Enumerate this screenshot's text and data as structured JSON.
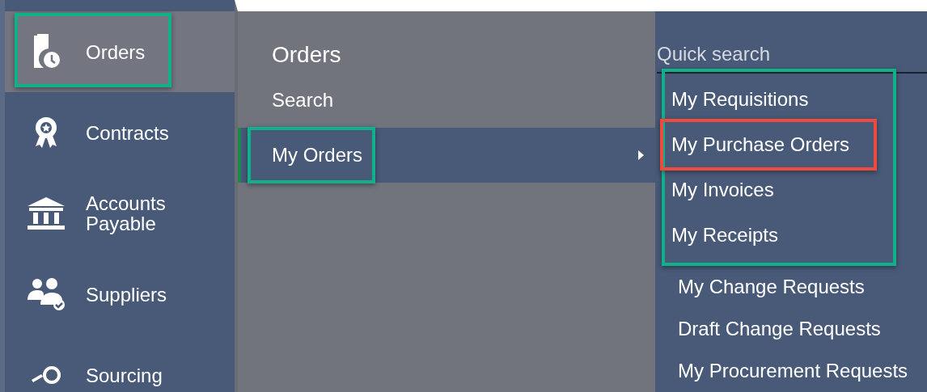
{
  "sidebar": {
    "items": [
      {
        "label": "Orders",
        "kind": "orders",
        "selected": true,
        "highlighted": true
      },
      {
        "label": "Contracts",
        "kind": "contracts",
        "selected": false,
        "highlighted": false
      },
      {
        "label": "Accounts Payable",
        "kind": "bank",
        "selected": false,
        "highlighted": false
      },
      {
        "label": "Suppliers",
        "kind": "suppliers",
        "selected": false,
        "highlighted": false
      },
      {
        "label": "Sourcing",
        "kind": "sourcing",
        "selected": false,
        "highlighted": false
      }
    ]
  },
  "submenu": {
    "title": "Orders",
    "items": [
      {
        "label": "Search",
        "selected": false,
        "highlighted": false,
        "has_children": false
      },
      {
        "label": "My Orders",
        "selected": true,
        "highlighted": true,
        "has_children": true
      }
    ]
  },
  "links_panel": {
    "search": {
      "placeholder": "Quick search"
    },
    "links": [
      {
        "label": "My Requisitions",
        "in_group": true,
        "marked": false
      },
      {
        "label": "My Purchase Orders",
        "in_group": true,
        "marked": true
      },
      {
        "label": "My Invoices",
        "in_group": true,
        "marked": false
      },
      {
        "label": "My Receipts",
        "in_group": true,
        "marked": false
      },
      {
        "label": "My Change Requests",
        "in_group": false,
        "marked": false
      },
      {
        "label": "Draft Change Requests",
        "in_group": false,
        "marked": false
      },
      {
        "label": "My Procurement Requests",
        "in_group": false,
        "marked": false
      }
    ]
  }
}
